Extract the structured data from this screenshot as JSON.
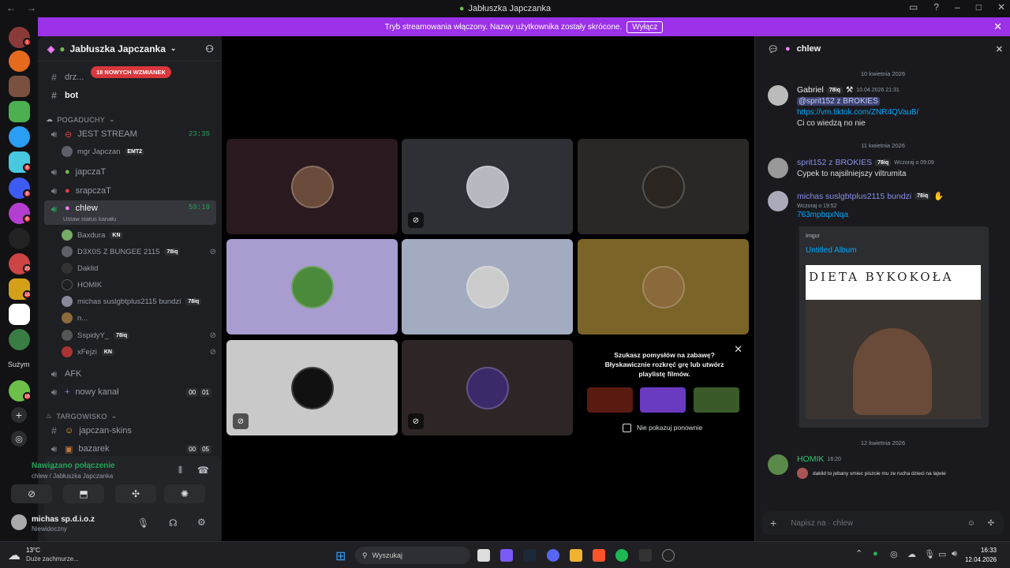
{
  "window": {
    "title": "Jabłuszka Japczanka"
  },
  "banner": {
    "text": "Tryb streamowania włączony. Nazwy użytkownika zostały skrócone.",
    "button": "Wyłącz"
  },
  "guild_badges": [
    "1",
    "6",
    "8",
    "6",
    "60",
    "29",
    "18",
    "18"
  ],
  "guild_label": "Sużym",
  "server": {
    "name": "Jabłuszka Japczanka"
  },
  "new_mentions": "18 NOWYCH WZMIANEK",
  "channels": {
    "dr": "drz...",
    "bot": "bot",
    "category_pogaduchy": "POGADUCHY",
    "jest_stream": "JEST STREAM",
    "jest_stream_time": "23:35",
    "mgr_japczan": "mgr Japczan",
    "mgr_tag": "EMT2",
    "japczat": "japczaT",
    "srapczat": "srapczaT",
    "chlew": "chlew",
    "chlew_time": "59:19",
    "chlew_status": "Ustaw status kanału",
    "users": [
      {
        "name": "Baxdura",
        "tag": "KN"
      },
      {
        "name": "D3X0S Z BUNGEE 2115",
        "tag": "78iq"
      },
      {
        "name": "Daklid",
        "tag": ""
      },
      {
        "name": "HOMIK",
        "tag": ""
      },
      {
        "name": "michas suslgbtplus2115 bundzi",
        "tag": "78iq"
      },
      {
        "name": "n...",
        "tag": ""
      },
      {
        "name": "SspidyY_",
        "tag": "78iq"
      },
      {
        "name": "xFejzi",
        "tag": "KN"
      }
    ],
    "afk": "AFK",
    "nowy_kanal": "nowy kanał",
    "nowy_kanal_c1": "00",
    "nowy_kanal_c2": "01",
    "category_targowisko": "TARGOWISKO",
    "japczan_skins": "japczan-skins",
    "bazarek": "bazarek",
    "bazarek_c1": "00",
    "bazarek_c2": "05"
  },
  "voice_panel": {
    "status": "Nawiązano połączenie",
    "location": "chlew / Jabłuszka Japczanka"
  },
  "account": {
    "name": "michas sp.d.i.o.z",
    "status": "Niewidoczny"
  },
  "promo": {
    "title": "Szukasz pomysłów na zabawę? Błyskawicznie rozkręć grę lub utwórz playlistę filmów.",
    "checkbox": "Nie pokazuj ponownie"
  },
  "chat": {
    "channel": "chlew",
    "dates": [
      "10 kwietnia 2026",
      "11 kwietnia 2026",
      "12 kwietnia 2026"
    ],
    "messages": [
      {
        "author": "Gabriel",
        "tag": "78iq",
        "time": "10.04.2026 21:31",
        "mention": "@sprit152 z BROKIES",
        "link": "https://vm.tiktok.com/ZNR4QVauB/",
        "text": "Ci co wiedzą no nie"
      },
      {
        "author": "sprit152 z BROKIES",
        "tag": "78iq",
        "time": "Wczoraj o 09:09",
        "text": "Cypek to najsilniejszy viltrumita"
      },
      {
        "author": "michas suslgbtplus2115 bundzi",
        "tag": "78iq",
        "time": "Wczoraj o 19:52",
        "text": "763mpbqxNqa"
      },
      {
        "author": "HOMIK",
        "time": "16:20",
        "reply_text": "daklid to jebany smiec piszcie mu ze rucha dzieci na lajwie"
      }
    ],
    "embed": {
      "provider": "Imgur",
      "title": "Untitled Album",
      "image_text": "DIETA BYKOKOŁA"
    },
    "input_placeholder": "Napisz na  · chlew"
  },
  "taskbar": {
    "weather_temp": "13°C",
    "weather_desc": "Duże zachmurze...",
    "search": "Wyszukaj",
    "time": "16:33",
    "date": "12.04.2026"
  }
}
